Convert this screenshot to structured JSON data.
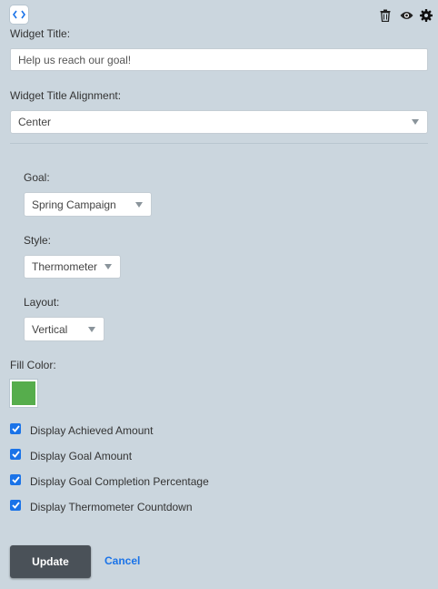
{
  "toolbar": {
    "code_icon": "code-icon",
    "delete_icon": "trash-icon",
    "preview_icon": "eye-icon",
    "settings_icon": "gear-icon"
  },
  "form": {
    "widget_title_label": "Widget Title:",
    "widget_title_value": "Help us reach our goal!",
    "alignment_label": "Widget Title Alignment:",
    "alignment_value": "Center",
    "goal_label": "Goal:",
    "goal_value": "Spring Campaign",
    "style_label": "Style:",
    "style_value": "Thermometer",
    "layout_label": "Layout:",
    "layout_value": "Vertical",
    "fill_color_label": "Fill Color:",
    "fill_color": "#56ad4c"
  },
  "options": [
    {
      "label": "Display Achieved Amount",
      "checked": true
    },
    {
      "label": "Display Goal Amount",
      "checked": true
    },
    {
      "label": "Display Goal Completion Percentage",
      "checked": true
    },
    {
      "label": "Display Thermometer Countdown",
      "checked": true
    }
  ],
  "actions": {
    "update_label": "Update",
    "cancel_label": "Cancel"
  },
  "colors": {
    "panel_bg": "#cbd6de",
    "accent": "#1a73e8",
    "button_dark": "#4a5158"
  }
}
